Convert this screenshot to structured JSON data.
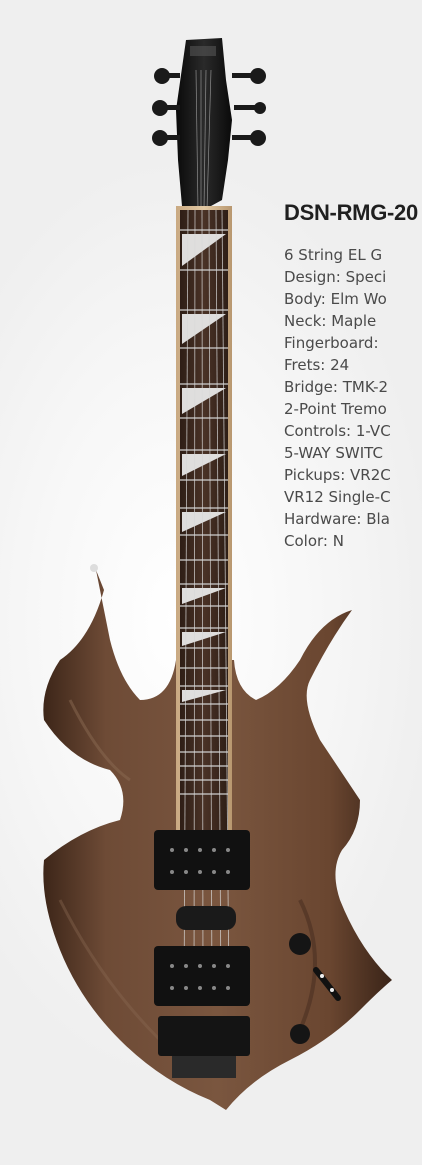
{
  "product": {
    "model": "DSN-RMG-20",
    "spec_lines": [
      "6 String EL G",
      "Design: Speci",
      "Body: Elm Wo",
      "Neck: Maple",
      "Fingerboard:",
      "Frets: 24",
      "Bridge: TMK-2",
      "2-Point Tremo",
      "Controls: 1-VC",
      "5-WAY SWITC",
      "Pickups: VR2C",
      "VR12 Single-C",
      "Hardware: Bla",
      "Color: N"
    ]
  },
  "colors": {
    "body_wood": "#6b4a35",
    "body_dark": "#4a3122",
    "fretboard": "#3e2a20",
    "inlay": "#e8e8e8",
    "hardware": "#111111",
    "heading": "#1f1f1f",
    "text": "#4a4a4a"
  },
  "icons": {
    "product_image": "electric-guitar-image"
  }
}
